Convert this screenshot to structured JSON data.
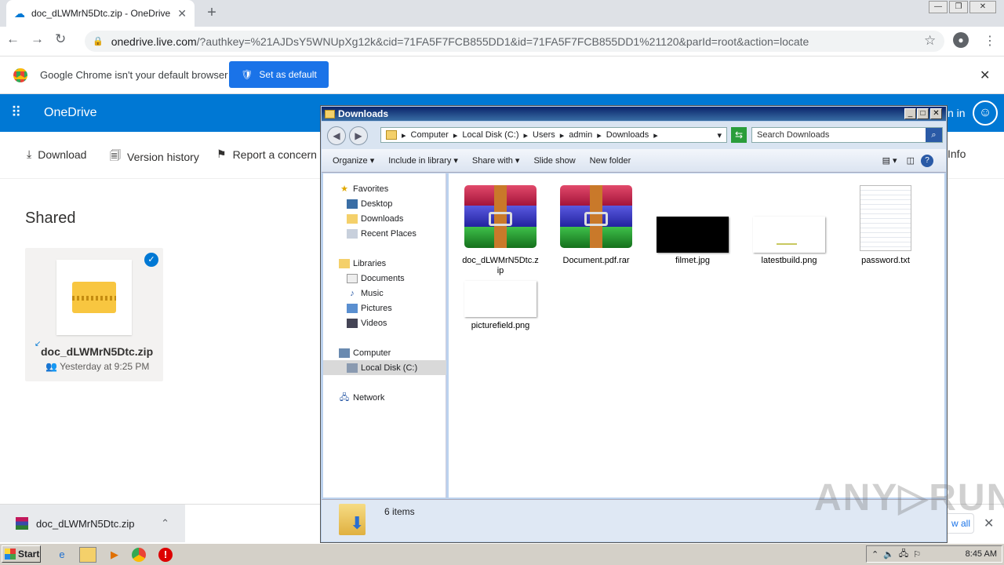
{
  "browser": {
    "tab_title": "doc_dLWMrN5Dtc.zip - OneDrive",
    "url_host": "onedrive.live.com",
    "url_path": "/?authkey=%21AJDsY5WNUpXg12k&cid=71FA5F7FCB855DD1&id=71FA5F7FCB855DD1%21120&parId=root&action=locate",
    "infobar_text": "Google Chrome isn't your default browser",
    "infobar_button": "Set as default"
  },
  "onedrive": {
    "brand": "OneDrive",
    "signin_partial": "n in",
    "commands": [
      "Download",
      "Version history",
      "Report a concern"
    ],
    "info_label": "Info",
    "section_title": "Shared",
    "tile": {
      "name": "doc_dLWMrN5Dtc.zip",
      "date": "Yesterday at 9:25 PM"
    }
  },
  "download_shelf": {
    "item": "doc_dLWMrN5Dtc.zip",
    "show_all": "w all"
  },
  "explorer": {
    "title": "Downloads",
    "breadcrumb": [
      "Computer",
      "Local Disk (C:)",
      "Users",
      "admin",
      "Downloads"
    ],
    "search_placeholder": "Search Downloads",
    "toolbar": [
      "Organize",
      "Include in library",
      "Share with",
      "Slide show",
      "New folder"
    ],
    "nav": {
      "favorites": "Favorites",
      "fav_items": [
        "Desktop",
        "Downloads",
        "Recent Places"
      ],
      "libraries": "Libraries",
      "lib_items": [
        "Documents",
        "Music",
        "Pictures",
        "Videos"
      ],
      "computer": "Computer",
      "comp_items": [
        "Local Disk (C:)"
      ],
      "network": "Network"
    },
    "files": [
      {
        "name": "doc_dLWMrN5Dtc.zip",
        "kind": "archive"
      },
      {
        "name": "Document.pdf.rar",
        "kind": "archive"
      },
      {
        "name": "filmet.jpg",
        "kind": "image-dark"
      },
      {
        "name": "latestbuild.png",
        "kind": "image-light"
      },
      {
        "name": "password.txt",
        "kind": "text"
      },
      {
        "name": "picturefield.png",
        "kind": "image-light"
      }
    ],
    "status": "6 items"
  },
  "taskbar": {
    "start": "Start",
    "clock": "8:45 AM"
  },
  "watermark": "ANY RUN"
}
